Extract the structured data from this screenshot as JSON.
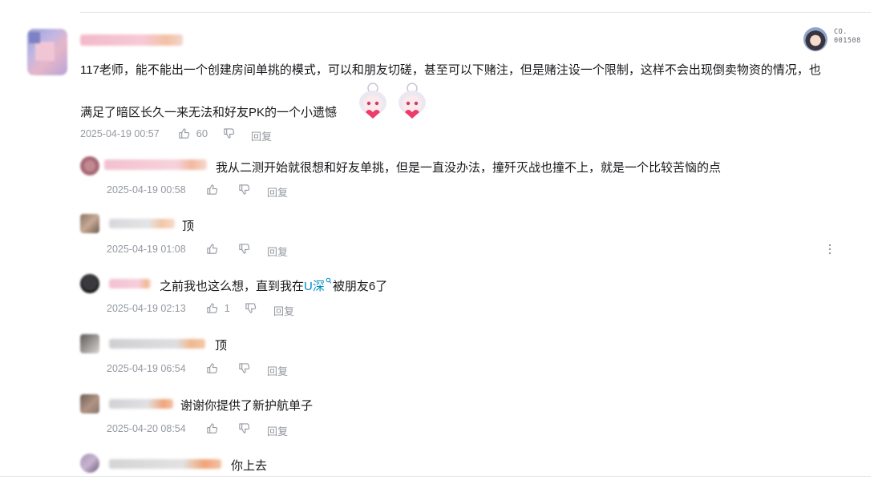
{
  "main_comment": {
    "text_line1": "117老师，能不能出一个创建房间单挑的模式，可以和朋友切磋，甚至可以下赌注，但是赌注设一个限制，这样不会出现倒卖物资的情况，也",
    "text_line2": "满足了暗区长久一来无法和好友PK的一个小遗憾",
    "timestamp": "2025-04-19 00:57",
    "like_count": "60",
    "reply_label": "回复",
    "badge_line1": "CO.",
    "badge_line2": "001508"
  },
  "replies": [
    {
      "text": "我从二测开始就很想和好友单挑，但是一直没办法，撞歼灭战也撞不上，就是一个比较苦恼的点",
      "timestamp": "2025-04-19 00:58",
      "like_count": "",
      "reply_label": "回复"
    },
    {
      "text": "顶",
      "timestamp": "2025-04-19 01:08",
      "like_count": "",
      "reply_label": "回复"
    },
    {
      "text_before": "之前我也这么想，直到我在",
      "link_text": "U深",
      "text_after": "被朋友6了",
      "timestamp": "2025-04-19 02:13",
      "like_count": "1",
      "reply_label": "回复"
    },
    {
      "text": "顶",
      "timestamp": "2025-04-19 06:54",
      "like_count": "",
      "reply_label": "回复"
    },
    {
      "text": "谢谢你提供了新护航单子",
      "timestamp": "2025-04-20 08:54",
      "like_count": "",
      "reply_label": "回复"
    },
    {
      "text": "你上去"
    }
  ],
  "colors": {
    "text": "#18191c",
    "meta": "#9499a0",
    "link": "#008ac5",
    "divider": "#e3e5e7"
  },
  "icons": [
    "thumb-up-icon",
    "thumb-down-icon",
    "more-vertical-icon",
    "search-icon"
  ]
}
